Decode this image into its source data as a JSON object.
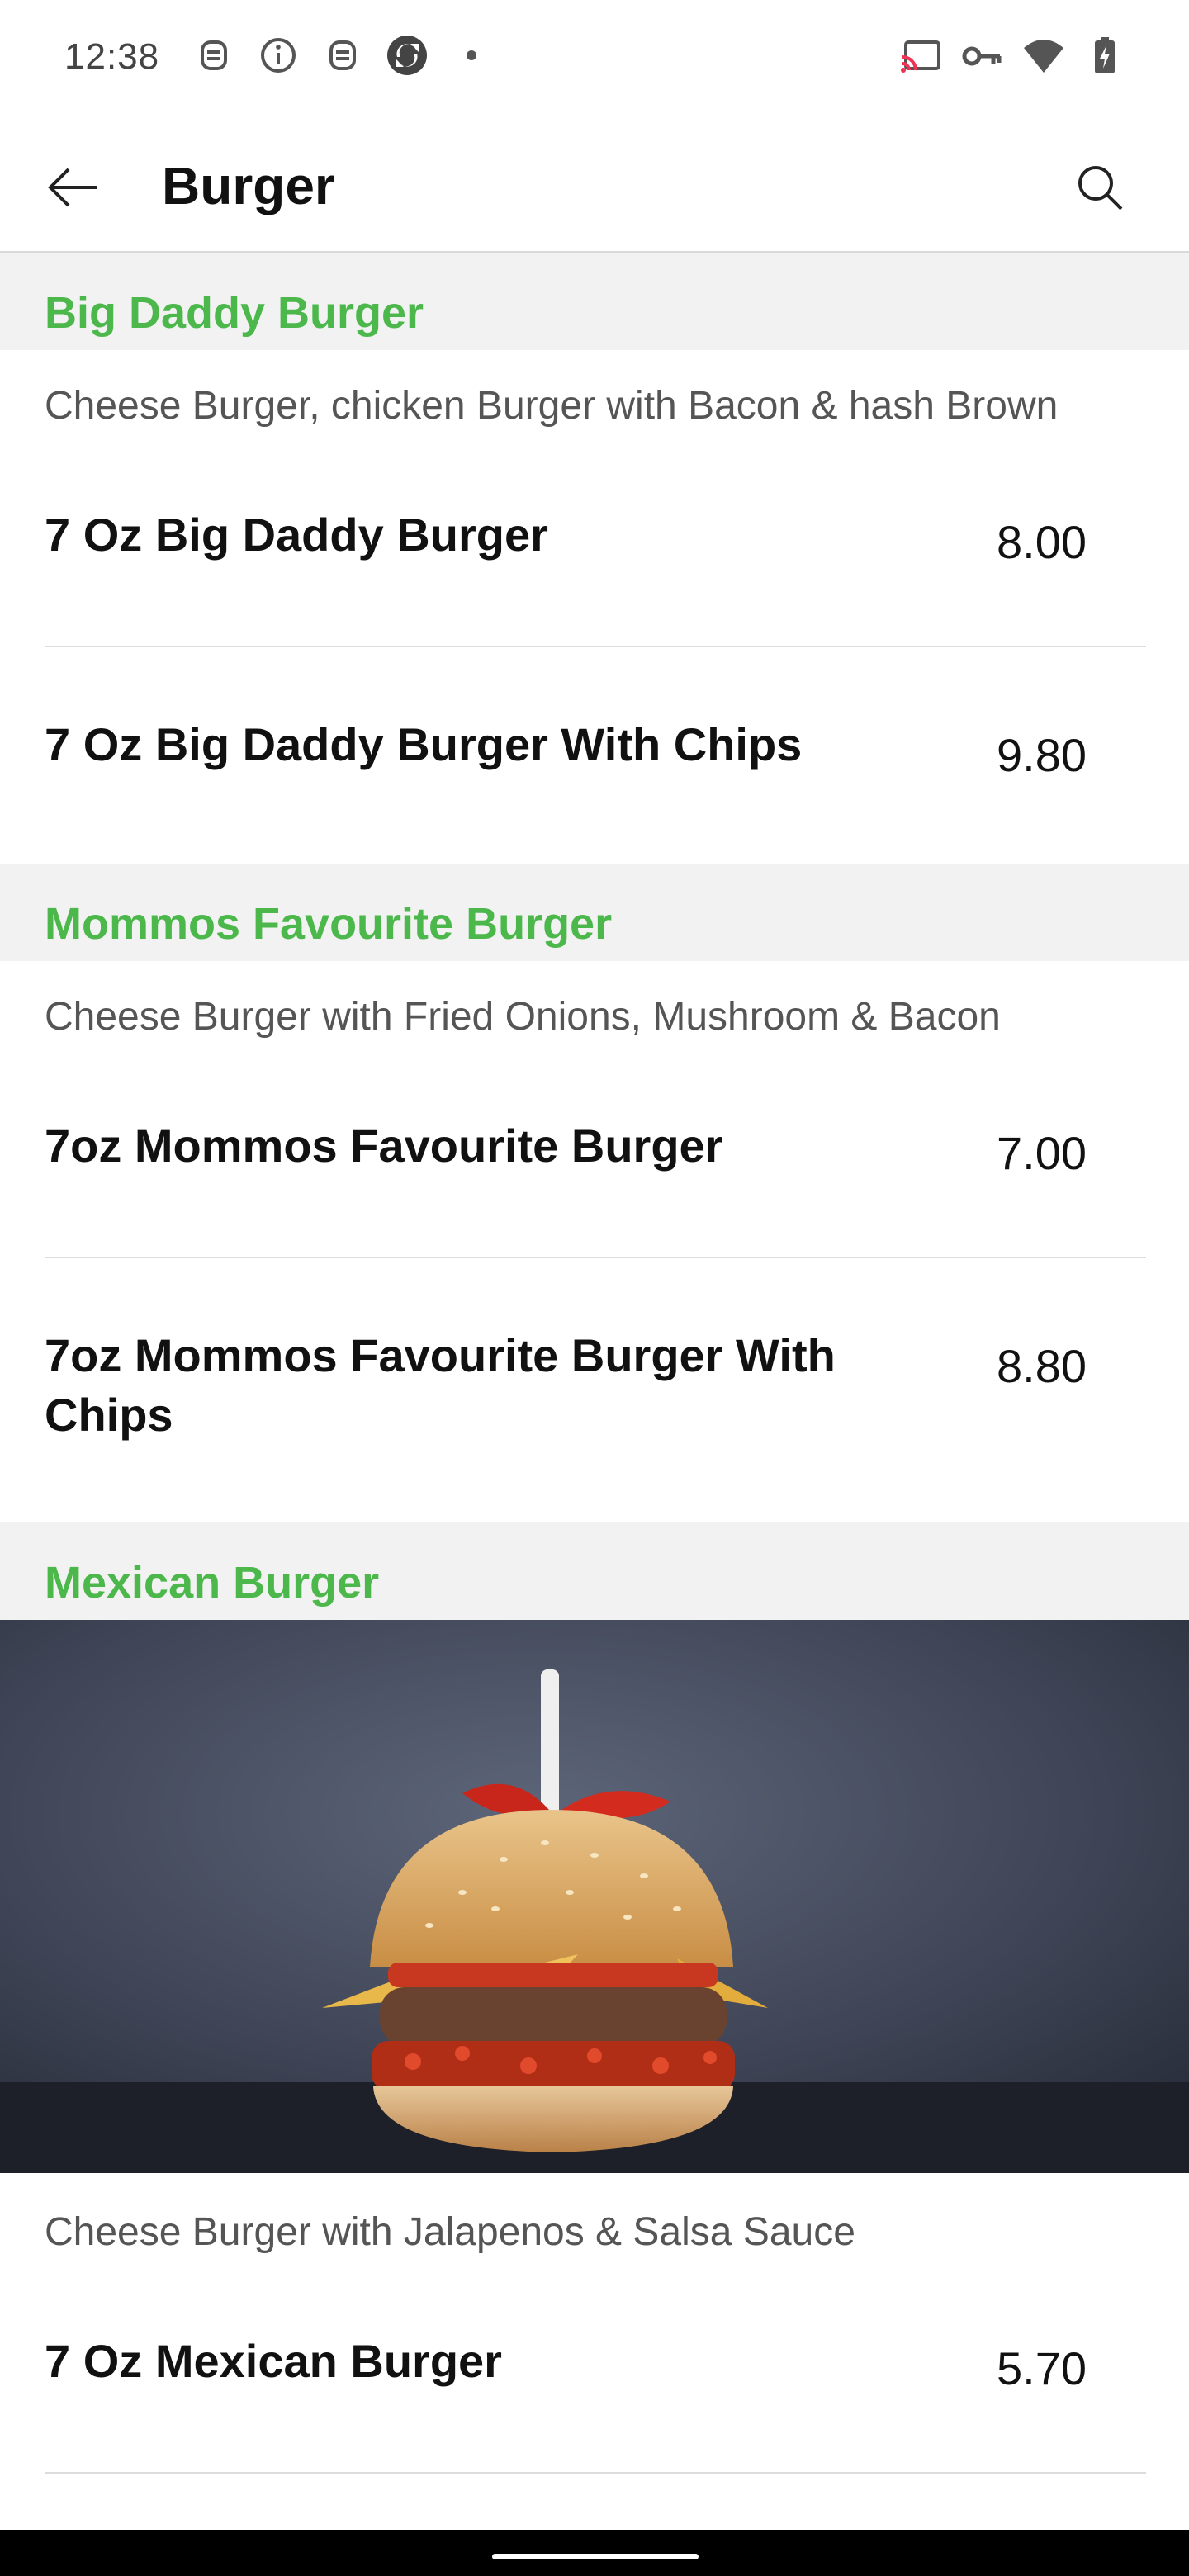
{
  "status_bar": {
    "time": "12:38",
    "left_icons": [
      "notification-app-icon",
      "info-icon",
      "notification-app-icon",
      "sync-app-icon",
      "dot-icon"
    ],
    "right_icons": [
      "cast-icon",
      "vpn-key-icon",
      "wifi-icon",
      "battery-charging-icon"
    ]
  },
  "app_bar": {
    "title": "Burger",
    "back_icon": "arrow-left-icon",
    "search_icon": "search-icon"
  },
  "accent_color": "#4cb84c",
  "sections": [
    {
      "title": "Big Daddy Burger",
      "description": "Cheese Burger, chicken Burger with Bacon & hash Brown",
      "items": [
        {
          "name": "7 Oz Big Daddy Burger",
          "price": "8.00"
        },
        {
          "name": "7 Oz Big Daddy Burger With Chips",
          "price": "9.80"
        }
      ]
    },
    {
      "title": "Mommos Favourite Burger",
      "description": "Cheese Burger with Fried Onions, Mushroom & Bacon",
      "items": [
        {
          "name": "7oz Mommos Favourite Burger",
          "price": "7.00"
        },
        {
          "name": "7oz Mommos Favourite Burger With Chips",
          "price": "8.80"
        }
      ]
    },
    {
      "title": "Mexican Burger",
      "description": "Cheese Burger with Jalapenos & Salsa Sauce",
      "items": [
        {
          "name": "7 Oz Mexican Burger",
          "price": "5.70"
        }
      ]
    }
  ]
}
